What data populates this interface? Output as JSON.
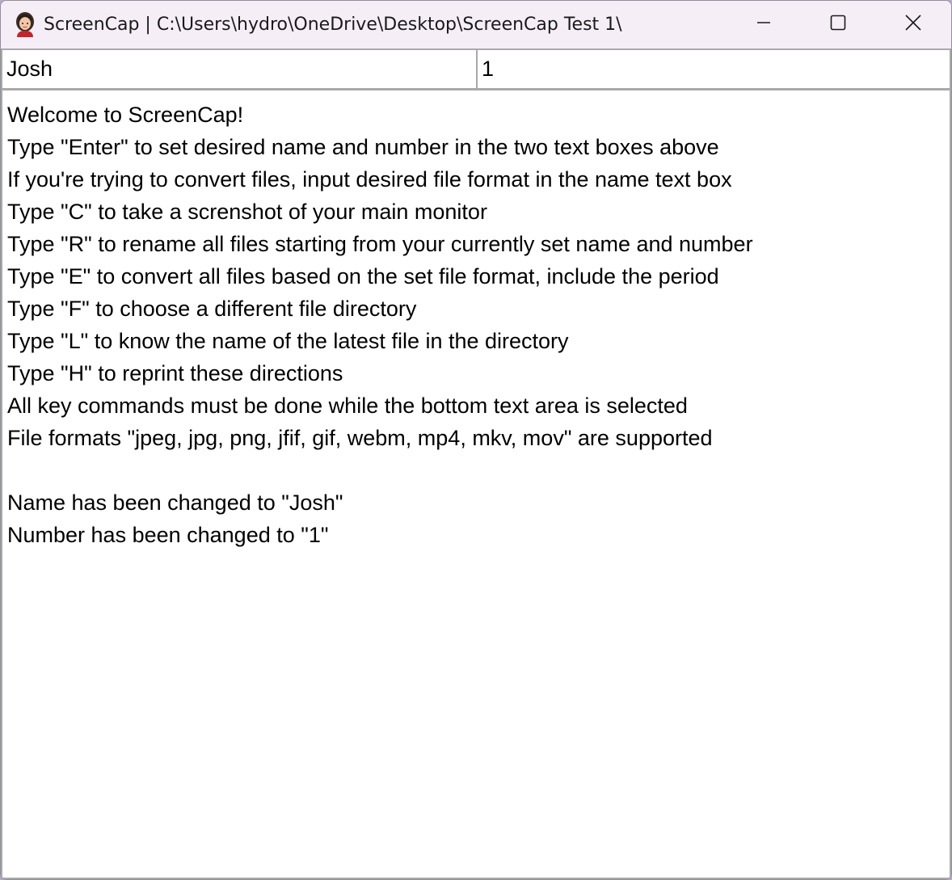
{
  "window": {
    "title": "ScreenCap | C:\\Users\\hydro\\OneDrive\\Desktop\\ScreenCap Test 1\\",
    "icon": "app-avatar-icon"
  },
  "caption_buttons": {
    "minimize_icon": "minimize-icon",
    "maximize_icon": "maximize-icon",
    "close_icon": "close-icon"
  },
  "inputs": {
    "name_value": "Josh",
    "number_value": "1"
  },
  "output": {
    "lines": [
      "Welcome to ScreenCap!",
      "Type \"Enter\" to set desired name and number in the two text boxes above",
      "If you're trying to convert files, input desired file format in the name text box",
      "Type \"C\" to take a screnshot of your main monitor",
      "Type \"R\" to rename all files starting from your currently set name and number",
      "Type \"E\" to convert all files based on the set file format, include the period",
      "Type \"F\" to choose a different file directory",
      "Type \"L\" to know the name of the latest file in the directory",
      "Type \"H\" to reprint these directions",
      "All key commands must be done while the bottom text area is selected",
      "File formats \"jpeg, jpg, png, jfif, gif, webm, mp4, mkv, mov\" are supported",
      "",
      "Name has been changed to \"Josh\"",
      "Number has been changed to \"1\""
    ]
  },
  "colors": {
    "titlebar_bg": "#f5eef7",
    "field_border": "#a9a9a9",
    "text": "#000000"
  }
}
